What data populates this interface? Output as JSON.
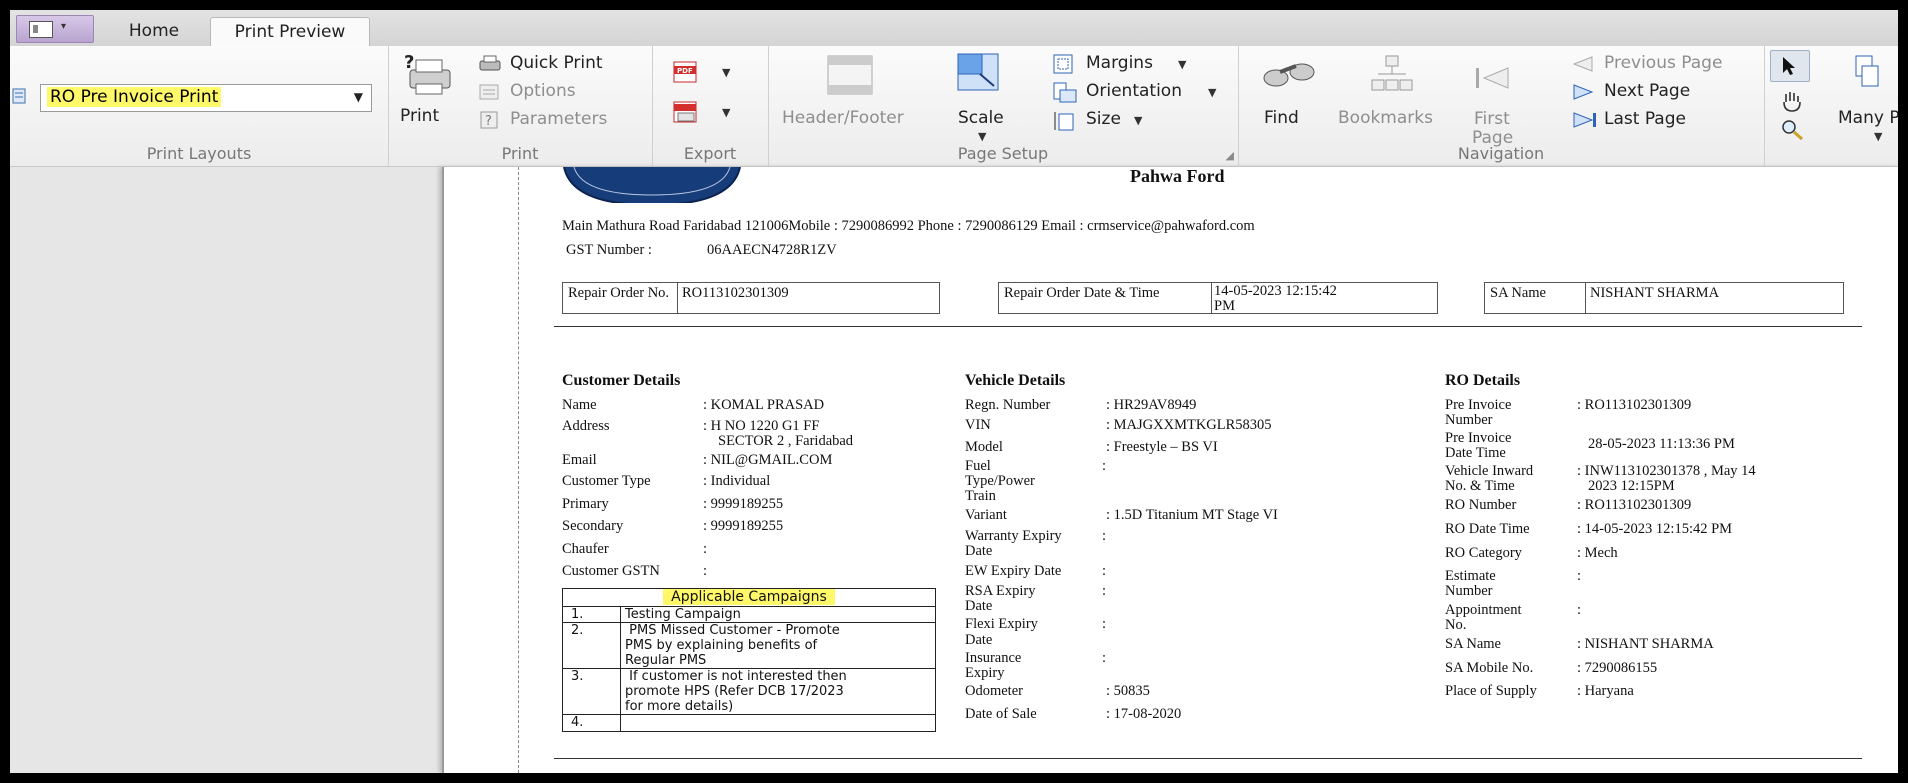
{
  "tabs": [
    "Home",
    "Print Preview"
  ],
  "ribbon": {
    "print_layouts": {
      "label": "Print Layouts",
      "selected": "RO Pre Invoice Print"
    },
    "print": {
      "label": "Print",
      "print": "Print",
      "quick_print": "Quick Print",
      "options": "Options",
      "parameters": "Parameters"
    },
    "export": {
      "label": "Export"
    },
    "page_setup": {
      "label": "Page Setup",
      "header_footer": "Header/Footer",
      "scale": "Scale",
      "margins": "Margins",
      "orientation": "Orientation",
      "size": "Size"
    },
    "navigation": {
      "label": "Navigation",
      "find": "Find",
      "bookmarks": "Bookmarks",
      "first_page_1": "First",
      "first_page_2": "Page",
      "previous_page": "Previous Page",
      "next_page": "Next Page",
      "last_page": "Last Page"
    },
    "zoom": {
      "many_pages": "Many P"
    }
  },
  "document": {
    "dealer_name": "Pahwa Ford",
    "address_line": "Main Mathura Road Faridabad 121006Mobile : 7290086992 Phone : 7290086129  Email : crmservice@pahwaford.com",
    "gst_label": "GST Number :",
    "gst_value": "06AAECN4728R1ZV",
    "repair_order_label": "Repair Order No.",
    "repair_order_value": "RO113102301309",
    "ro_date_label": "Repair Order Date & Time",
    "ro_date_value_1": "14-05-2023 12:15:42",
    "ro_date_value_2": "PM",
    "sa_name_label": "SA Name",
    "sa_name_value": "NISHANT   SHARMA",
    "customer": {
      "title": "Customer Details",
      "rows": [
        {
          "label": "Name",
          "value": ": KOMAL PRASAD"
        },
        {
          "label": "Address",
          "value": ": H NO 1220 G1 FF"
        },
        {
          "label": "",
          "value": "SECTOR 2 , Faridabad"
        },
        {
          "label": "Email",
          "value": ": NIL@GMAIL.COM"
        },
        {
          "label": "Customer Type",
          "value": ": Individual"
        },
        {
          "label": "Primary",
          "value": ": 9999189255"
        },
        {
          "label": "Secondary",
          "value": ": 9999189255"
        },
        {
          "label": "Chaufer",
          "value": ":"
        },
        {
          "label": "Customer GSTN",
          "value": ":"
        }
      ]
    },
    "campaigns": {
      "title": "Applicable Campaigns",
      "rows": [
        {
          "num": "1.",
          "text": [
            "Testing Campaign"
          ]
        },
        {
          "num": "2.",
          "text": [
            " PMS Missed Customer - Promote",
            "PMS by explaining benefits of",
            "Regular PMS"
          ]
        },
        {
          "num": "3.",
          "text": [
            " If customer is not interested then",
            "promote HPS (Refer DCB 17/2023",
            "for more details)"
          ]
        },
        {
          "num": "4.",
          "text": [
            ""
          ]
        }
      ]
    },
    "vehicle": {
      "title": "Vehicle Details",
      "regn_label": "Regn. Number",
      "regn_value": ": HR29AV8949",
      "vin_label": "VIN",
      "vin_value": ": MAJGXXMTKGLR58305",
      "model_label": "Model",
      "model_value": ": Freestyle – BS VI",
      "fuel_label_1": "Fuel",
      "fuel_label_2": "Type/Power",
      "fuel_label_3": "Train",
      "fuel_value": ":",
      "variant_label": "Variant",
      "variant_value": ": 1.5D Titanium MT Stage VI",
      "warranty_label_1": "Warranty Expiry",
      "warranty_label_2": "Date",
      "warranty_value": ":",
      "ew_label": "EW Expiry Date",
      "ew_value": ":",
      "rsa_label_1": "RSA Expiry",
      "rsa_label_2": "Date",
      "rsa_value": ":",
      "flexi_label_1": "Flexi Expiry",
      "flexi_label_2": "Date",
      "flexi_value": ":",
      "insurance_label_1": "Insurance",
      "insurance_label_2": "Expiry",
      "insurance_value": ":",
      "odometer_label": "Odometer",
      "odometer_value": ": 50835",
      "sale_label": "Date of Sale",
      "sale_value": ": 17-08-2020"
    },
    "ro": {
      "title": "RO Details",
      "pre_inv_no_label_1": "Pre Invoice",
      "pre_inv_no_label_2": "Number",
      "pre_inv_no_value": ": RO113102301309",
      "pre_inv_dt_label_1": "Pre Invoice",
      "pre_inv_dt_label_2": "Date Time",
      "pre_inv_dt_value": "28-05-2023 11:13:36 PM",
      "inward_label_1": "Vehicle Inward",
      "inward_label_2": "No. & Time",
      "inward_value_1": ": INW113102301378 , May 14",
      "inward_value_2": "2023 12:15PM",
      "ro_number_label": "RO Number",
      "ro_number_value": ": RO113102301309",
      "ro_dt_label": "RO Date Time",
      "ro_dt_value": ": 14-05-2023 12:15:42 PM",
      "ro_cat_label": "RO Category",
      "ro_cat_value": ": Mech",
      "estimate_label_1": "Estimate",
      "estimate_label_2": "Number",
      "estimate_value": ":",
      "appt_label_1": "Appointment",
      "appt_label_2": "No.",
      "appt_value": ":",
      "sa_label": "SA Name",
      "sa_value": ": NISHANT   SHARMA",
      "sa_mobile_label": "SA Mobile No.",
      "sa_mobile_value": ": 7290086155",
      "supply_label": "Place of Supply",
      "supply_value": ": Haryana"
    }
  }
}
